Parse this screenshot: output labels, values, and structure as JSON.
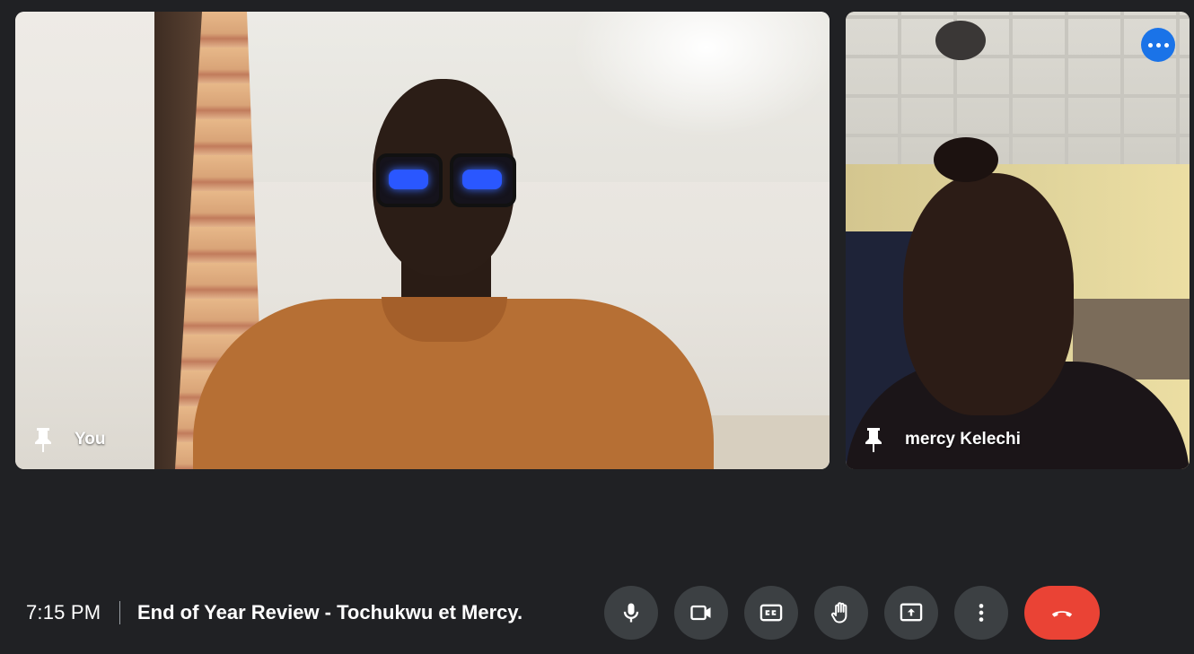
{
  "tiles": {
    "self": {
      "name": "You"
    },
    "remote": {
      "name": "mercy Kelechi"
    }
  },
  "bottom_bar": {
    "time": "7:15 PM",
    "meeting_title": "End of Year Review - Tochukwu et Mercy."
  },
  "controls": [
    {
      "name": "microphone",
      "icon": "mic-icon"
    },
    {
      "name": "camera",
      "icon": "videocam-icon"
    },
    {
      "name": "captions",
      "icon": "closed-caption-icon"
    },
    {
      "name": "raise-hand",
      "icon": "hand-icon"
    },
    {
      "name": "present",
      "icon": "present-screen-icon"
    },
    {
      "name": "more-options",
      "icon": "more-vert-icon"
    },
    {
      "name": "leave-call",
      "icon": "call-end-icon"
    }
  ],
  "colors": {
    "background": "#202124",
    "control": "#3c4043",
    "leave": "#ea4335",
    "accent": "#1a73e8"
  }
}
